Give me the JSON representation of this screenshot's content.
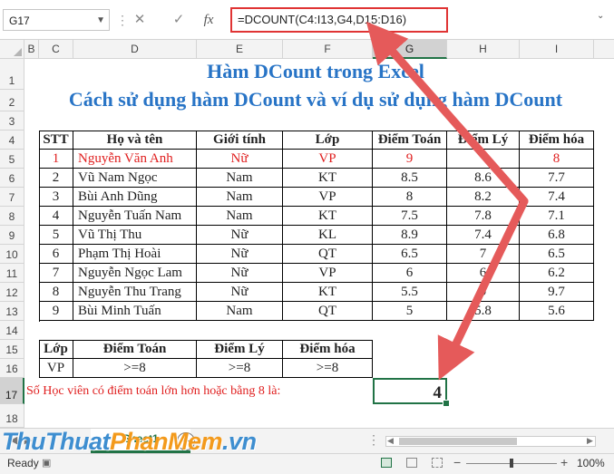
{
  "formula_bar": {
    "name_box": "G17",
    "cancel_icon": "✕",
    "enter_icon": "✓",
    "fx_label": "fx",
    "formula": "=DCOUNT(C4:I13,G4,D15:D16)"
  },
  "columns": [
    "B",
    "C",
    "D",
    "E",
    "F",
    "G",
    "H",
    "I"
  ],
  "rows": [
    "1",
    "2",
    "3",
    "4",
    "5",
    "6",
    "7",
    "8",
    "9",
    "10",
    "11",
    "12",
    "13",
    "14",
    "15",
    "16",
    "17",
    "18"
  ],
  "title": {
    "line1": "Hàm DCount trong Excel",
    "line2": "Cách sử dụng hàm DCount và ví dụ sử dụng hàm DCount"
  },
  "table": {
    "headers": [
      "STT",
      "Họ và tên",
      "Giới tính",
      "Lớp",
      "Điểm Toán",
      "Điểm Lý",
      "Điểm hóa"
    ],
    "rows": [
      [
        "1",
        "Nguyễn Văn Anh",
        "Nữ",
        "VP",
        "9",
        "",
        "8"
      ],
      [
        "2",
        "Vũ Nam Ngọc",
        "Nam",
        "KT",
        "8.5",
        "8.6",
        "7.7"
      ],
      [
        "3",
        "Bùi Anh Dũng",
        "Nam",
        "VP",
        "8",
        "8.2",
        "7.4"
      ],
      [
        "4",
        "Nguyễn Tuấn Nam",
        "Nam",
        "KT",
        "7.5",
        "7.8",
        "7.1"
      ],
      [
        "5",
        "Vũ Thị Thu",
        "Nữ",
        "KL",
        "8.9",
        "7.4",
        "6.8"
      ],
      [
        "6",
        "Phạm Thị Hoài",
        "Nữ",
        "QT",
        "6.5",
        "7",
        "6.5"
      ],
      [
        "7",
        "Nguyễn Ngọc Lam",
        "Nữ",
        "VP",
        "6",
        "6",
        "6.2"
      ],
      [
        "8",
        "Nguyễn Thu Trang",
        "Nữ",
        "KT",
        "5.5",
        "9",
        "9.7"
      ],
      [
        "9",
        "Bùi Minh Tuấn",
        "Nam",
        "QT",
        "5",
        "5.8",
        "5.6"
      ]
    ]
  },
  "criteria": {
    "headers": [
      "Lớp",
      "Điểm Toán",
      "Điểm Lý",
      "Điểm hóa"
    ],
    "values": [
      "VP",
      ">=8",
      ">=8",
      ">=8"
    ]
  },
  "result": {
    "label": "Số Học viên có điểm toán lớn hơn hoặc bằng 8 là:",
    "value": "4"
  },
  "sheet_tab": "Sheet1",
  "watermark": {
    "part1": "ThuThuat",
    "part2": "PhanMem",
    "part3": ".vn"
  },
  "status": {
    "ready": "Ready",
    "zoom": "100%"
  },
  "colors": {
    "title": "#2874c6",
    "highlight_red": "#e02020",
    "arrow": "#e55a5a",
    "excel_green": "#217346"
  }
}
